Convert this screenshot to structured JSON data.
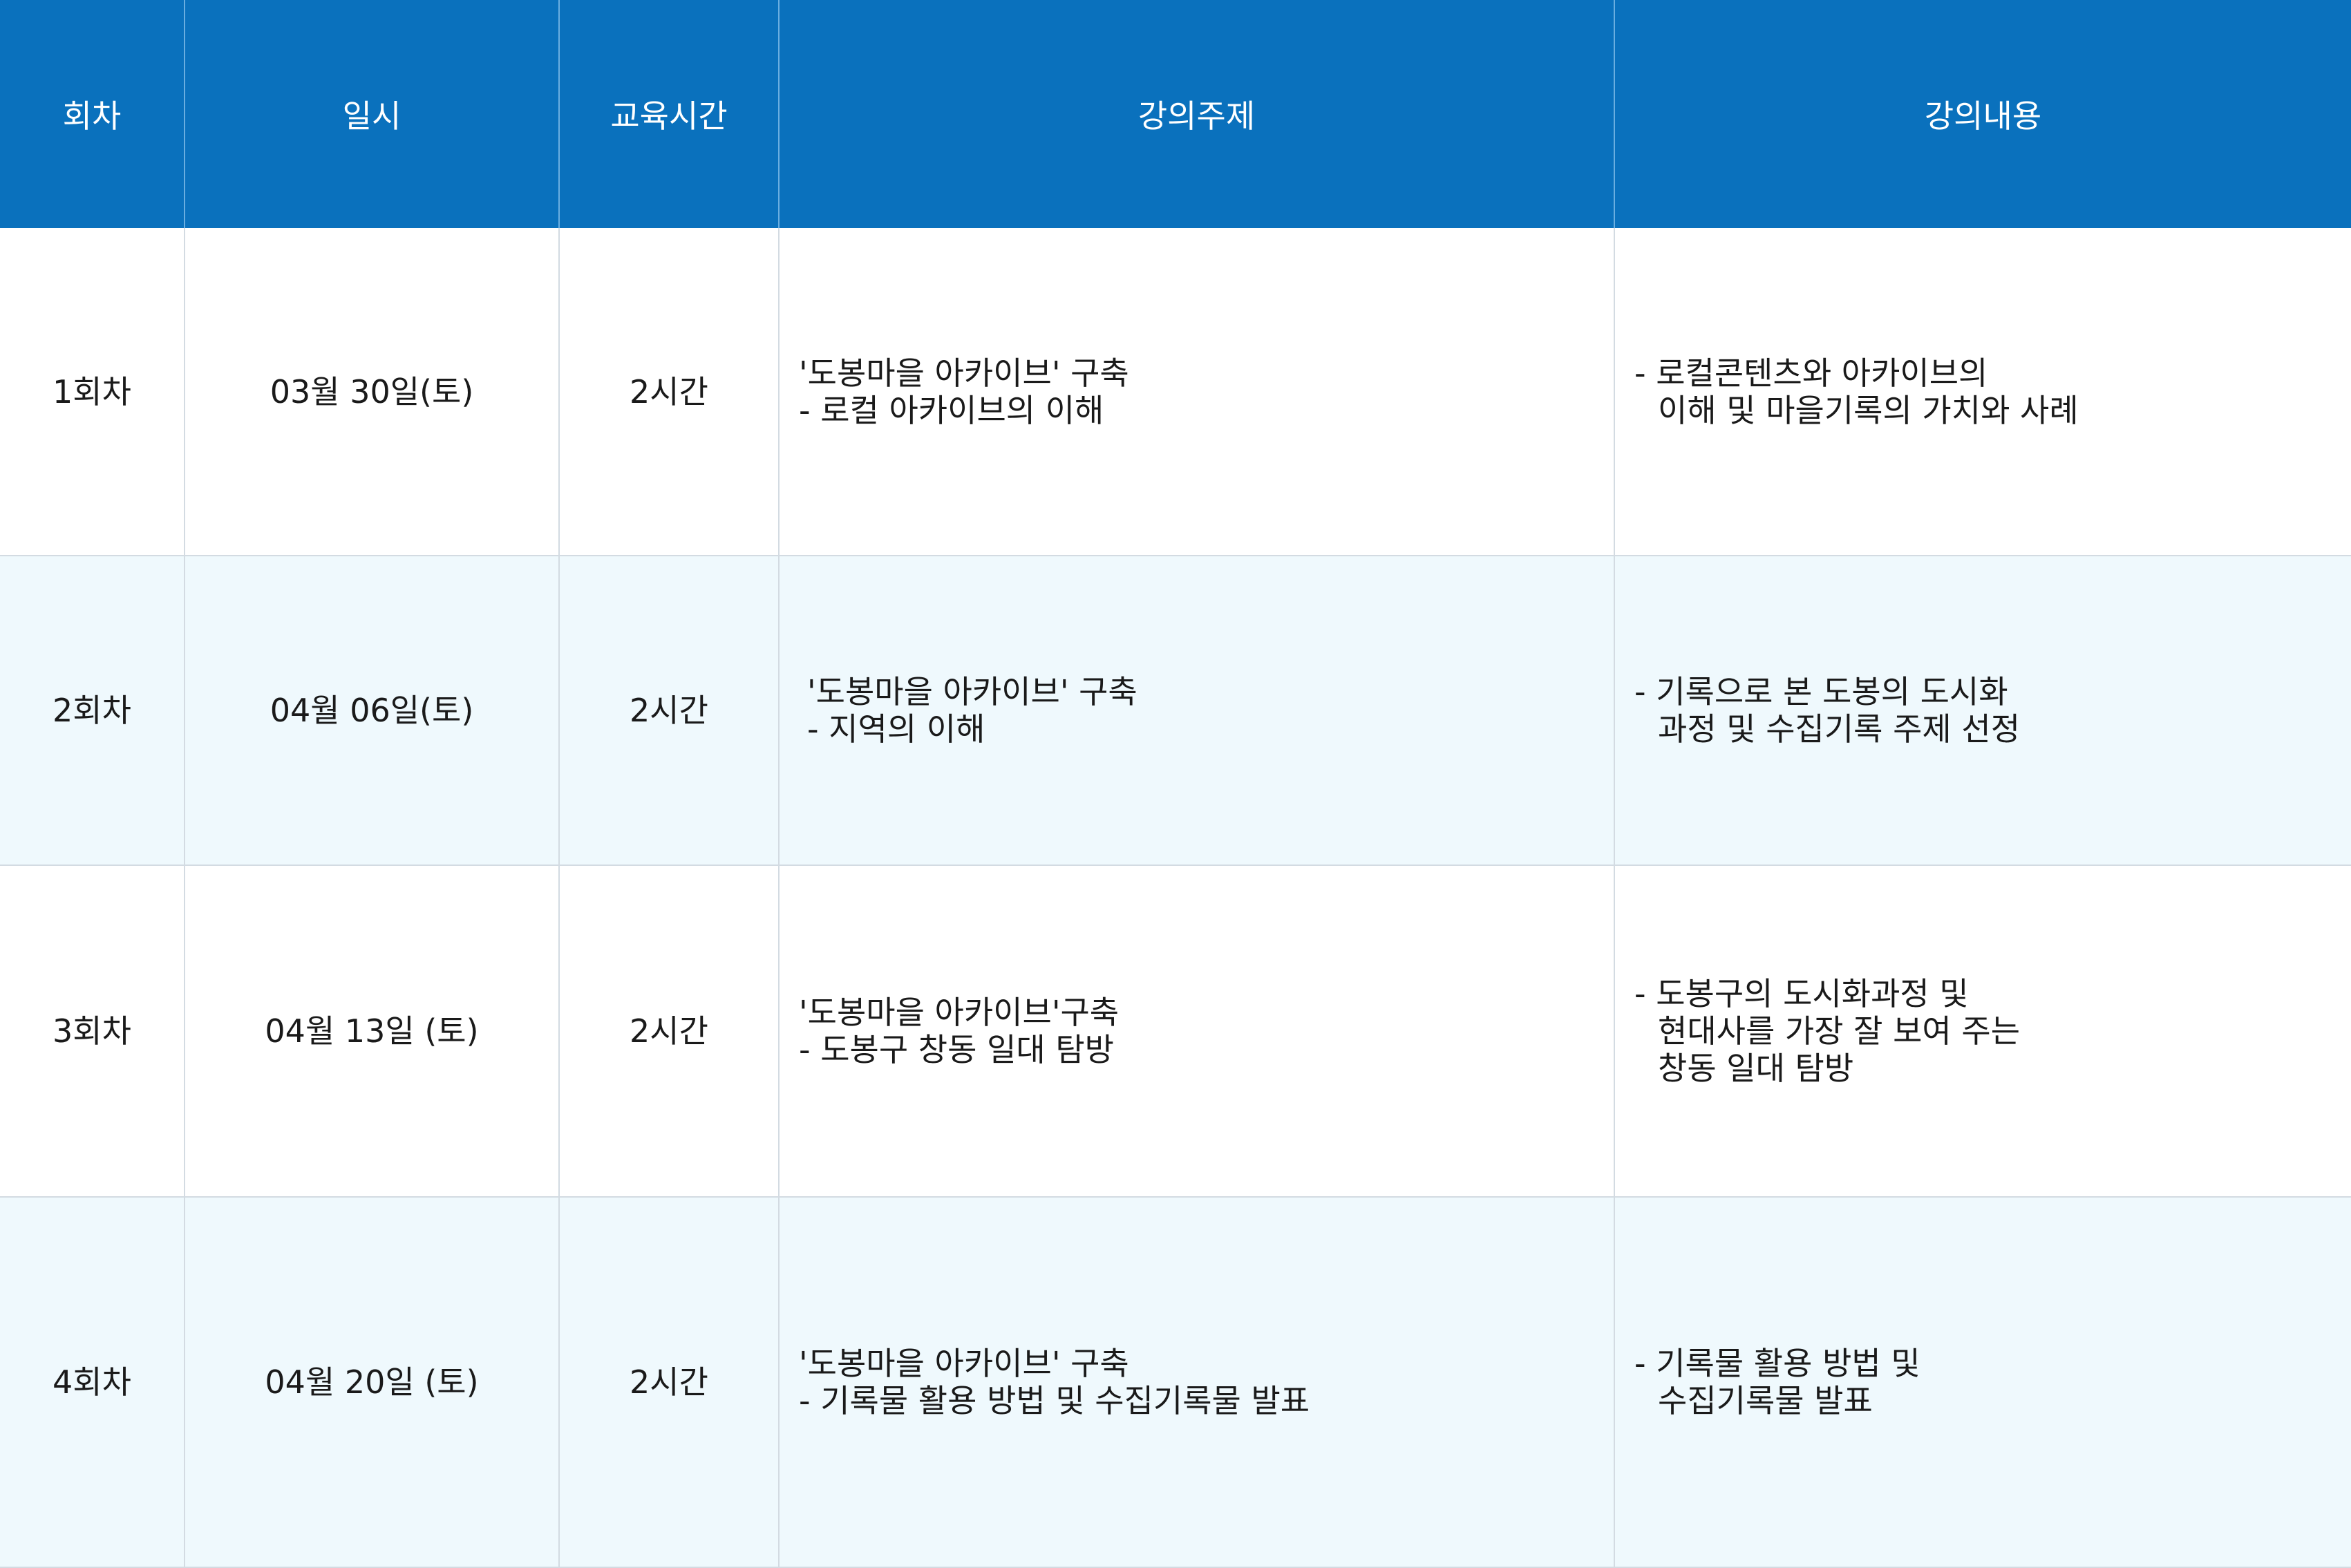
{
  "table": {
    "headers": [
      "회차",
      "일시",
      "교육시간",
      "강의주제",
      "강의내용"
    ],
    "rows": [
      {
        "session": "1회차",
        "date": "03월 30일(토)",
        "hours": "2시간",
        "topic": [
          "'도봉마을 아카이브' 구축",
          "- 로컬 아카이브의 이해"
        ],
        "content": [
          "- 로컬콘텐츠와 아카이브의",
          "이해 및 마을기록의 가치와 사례"
        ]
      },
      {
        "session": "2회차",
        "date": "04월 06일(토)",
        "hours": "2시간",
        "topic": [
          "'도봉마을 아카이브' 구축",
          "- 지역의 이해"
        ],
        "content": [
          "- 기록으로 본 도봉의 도시화",
          "과정 및 수집기록 주제 선정"
        ]
      },
      {
        "session": "3회차",
        "date": "04월 13일 (토)",
        "hours": "2시간",
        "topic": [
          "'도봉마을 아카이브'구축",
          "- 도봉구 창동 일대 탐방"
        ],
        "content": [
          "- 도봉구의 도시화과정 및",
          "현대사를 가장 잘 보여 주는",
          "창동 일대 탐방"
        ]
      },
      {
        "session": "4회차",
        "date": "04월 20일 (토)",
        "hours": "2시간",
        "topic": [
          "'도봉마을 아카이브' 구축",
          "- 기록물 활용 방법 및 수집기록물 발표"
        ],
        "content": [
          "- 기록물 활용 방법 및",
          "수집기록물 발표"
        ]
      }
    ]
  },
  "colors": {
    "header_bg": "#0a71bd",
    "alt_row_bg": "#eff9fd",
    "grid": "#d3dbe2"
  }
}
